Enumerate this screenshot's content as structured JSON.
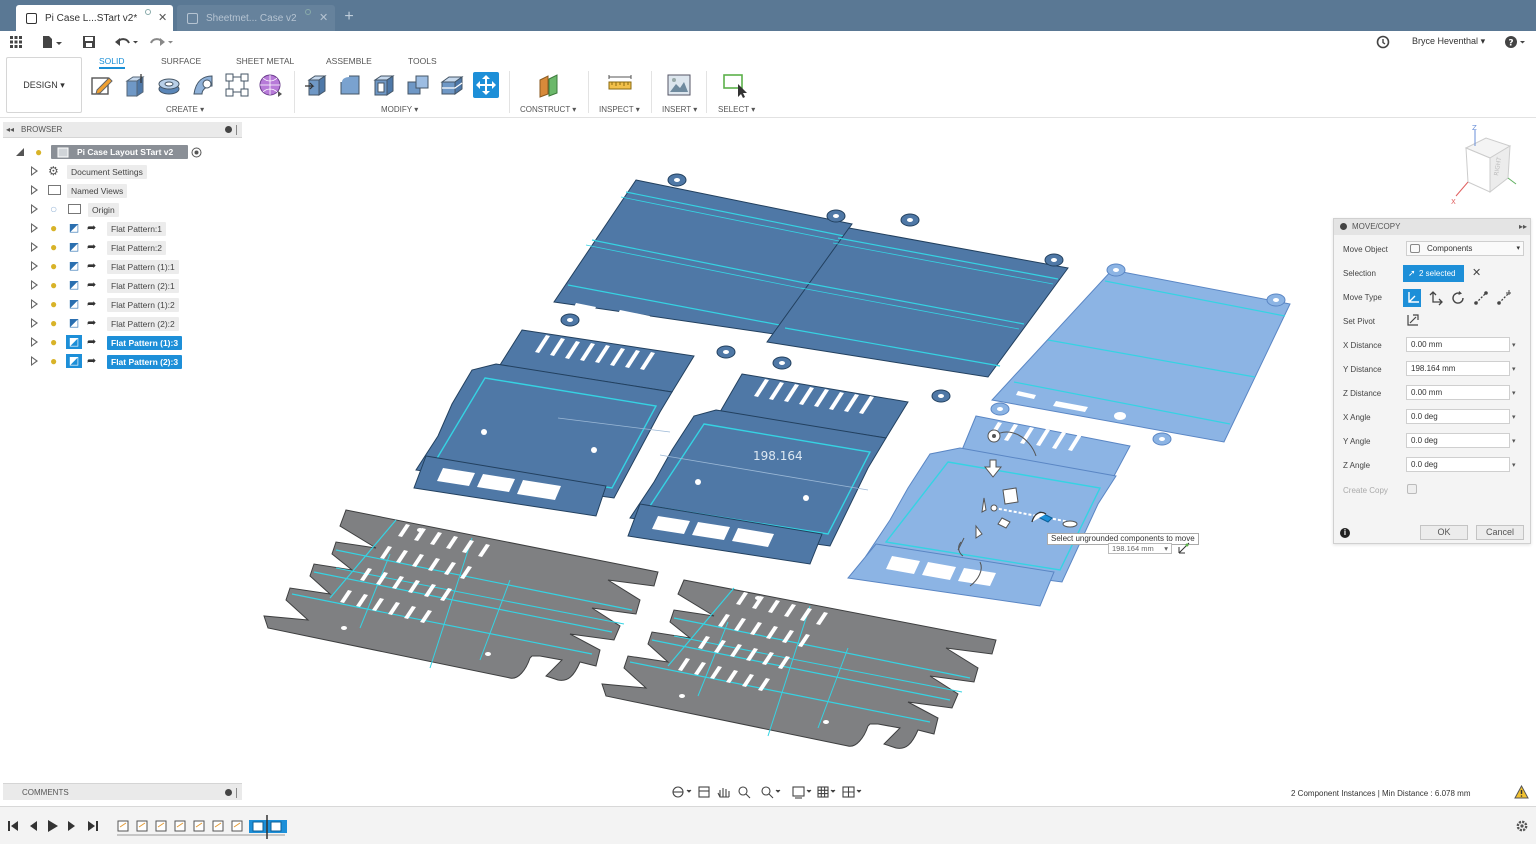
{
  "tabs": [
    {
      "label": "Pi Case L...STart v2*",
      "active": true
    },
    {
      "label": "Sheetmet... Case v2",
      "active": false
    }
  ],
  "user": {
    "name": "Bryce Heventhal"
  },
  "toolbar": {
    "workspace": "DESIGN",
    "tabs": [
      "SOLID",
      "SURFACE",
      "SHEET METAL",
      "ASSEMBLE",
      "TOOLS"
    ],
    "groups": [
      "CREATE",
      "MODIFY",
      "CONSTRUCT",
      "INSPECT",
      "INSERT",
      "SELECT"
    ]
  },
  "browser": {
    "title": "BROWSER",
    "root": "Pi Case Layout STart v2",
    "items": [
      {
        "label": "Document Settings",
        "selected": false
      },
      {
        "label": "Named Views",
        "selected": false
      },
      {
        "label": "Origin",
        "selected": false
      },
      {
        "label": "Flat Pattern:1",
        "selected": false
      },
      {
        "label": "Flat Pattern:2",
        "selected": false
      },
      {
        "label": "Flat Pattern (1):1",
        "selected": false
      },
      {
        "label": "Flat Pattern (2):1",
        "selected": false
      },
      {
        "label": "Flat Pattern (1):2",
        "selected": false
      },
      {
        "label": "Flat Pattern (2):2",
        "selected": false
      },
      {
        "label": "Flat Pattern (1):3",
        "selected": true
      },
      {
        "label": "Flat Pattern (2):3",
        "selected": true
      }
    ]
  },
  "viewcube": {
    "axis_z": "Z",
    "axis_x": "X",
    "face": "RIGHT"
  },
  "viewport": {
    "dimension_label": "198.164",
    "tooltip": "Select ungrounded components to move",
    "input_value": "198.164 mm"
  },
  "dialog": {
    "title": "MOVE/COPY",
    "move_object_label": "Move Object",
    "move_object_value": "Components",
    "selection_label": "Selection",
    "selection_value": "2 selected",
    "move_type_label": "Move Type",
    "set_pivot_label": "Set Pivot",
    "x_distance_label": "X Distance",
    "x_distance": "0.00 mm",
    "y_distance_label": "Y Distance",
    "y_distance": "198.164 mm",
    "z_distance_label": "Z Distance",
    "z_distance": "0.00 mm",
    "x_angle_label": "X Angle",
    "x_angle": "0.0 deg",
    "y_angle_label": "Y Angle",
    "y_angle": "0.0 deg",
    "z_angle_label": "Z Angle",
    "z_angle": "0.0 deg",
    "create_copy_label": "Create Copy",
    "ok_label": "OK",
    "cancel_label": "Cancel"
  },
  "comments": {
    "title": "COMMENTS"
  },
  "status": {
    "text": "2 Component Instances | Min Distance : 6.078 mm"
  },
  "colors": {
    "accent": "#1d8fd8",
    "tab_bar": "#5a7894",
    "panel_blue": "#4f78a6",
    "panel_blue_light": "#8cb4e4",
    "edge_cyan": "#35d3e3",
    "vent_gray": "#7f8082"
  }
}
